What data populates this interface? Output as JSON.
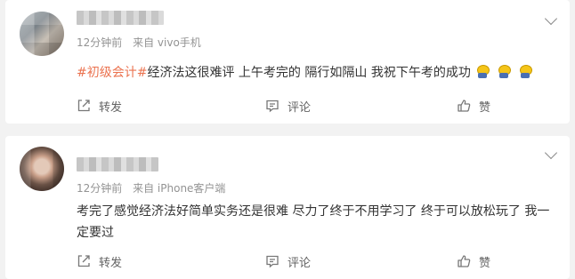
{
  "posts": [
    {
      "meta": {
        "time": "12分钟前",
        "source": "来自 vivo手机"
      },
      "content": {
        "tag": "#初级会计#",
        "text": "经济法这很难评 上午考完的 隔行如隔山 我祝下午考的成功"
      },
      "actions": {
        "repost": "转发",
        "comment": "评论",
        "like": "赞"
      }
    },
    {
      "meta": {
        "time": "12分钟前",
        "source": "来自 iPhone客户端"
      },
      "content": {
        "text": "考完了感觉经济法好简单实务还是很难 尽力了终于不用学习了 终于可以放松玩了 我一定要过"
      },
      "actions": {
        "repost": "转发",
        "comment": "评论",
        "like": "赞"
      }
    }
  ],
  "icons": {
    "repost": "repost-icon",
    "comment": "comment-icon",
    "like": "thumbs-up-icon",
    "chevron": "chevron-down-icon",
    "emoji": "emoji-icon"
  },
  "colors": {
    "tag": "#eb7350",
    "meta": "#939393",
    "action": "#636363"
  }
}
